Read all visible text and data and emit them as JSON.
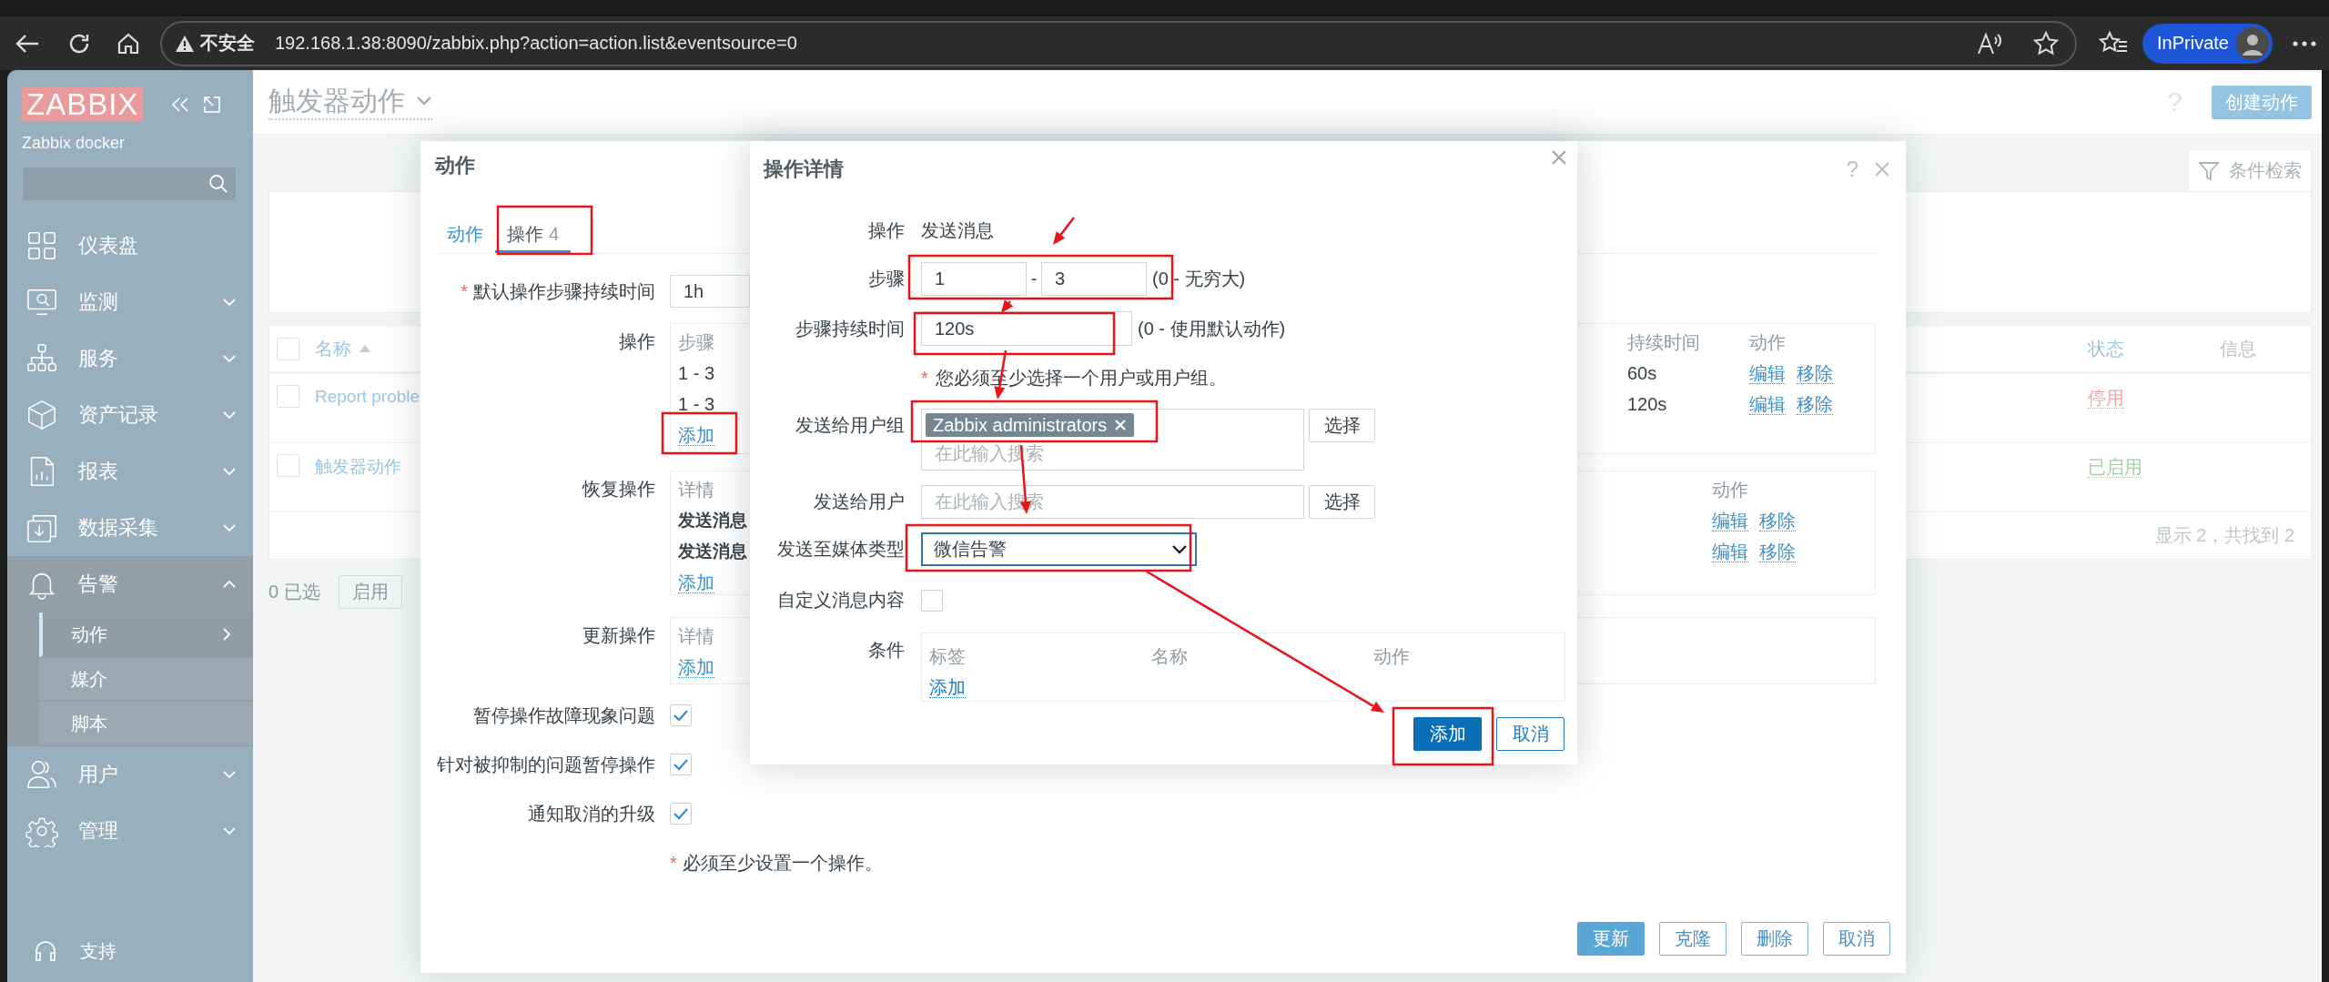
{
  "browser": {
    "security_label": "不安全",
    "url": "192.168.1.38:8090/zabbix.php?action=action.list&eventsource=0",
    "profile_label": "InPrivate"
  },
  "sidebar": {
    "logo": "ZABBIX",
    "server_name": "Zabbix docker",
    "menu": [
      {
        "label": "仪表盘",
        "kind": "link"
      },
      {
        "label": "监测",
        "kind": "group",
        "expanded": false
      },
      {
        "label": "服务",
        "kind": "group",
        "expanded": false
      },
      {
        "label": "资产记录",
        "kind": "group",
        "expanded": false
      },
      {
        "label": "报表",
        "kind": "group",
        "expanded": false
      },
      {
        "label": "数据采集",
        "kind": "group",
        "expanded": false
      },
      {
        "label": "告警",
        "kind": "group",
        "expanded": true,
        "children": [
          {
            "label": "动作",
            "selected": true
          },
          {
            "label": "媒介",
            "selected": false
          },
          {
            "label": "脚本",
            "selected": false
          }
        ]
      },
      {
        "label": "用户",
        "kind": "group",
        "expanded": false
      },
      {
        "label": "管理",
        "kind": "group",
        "expanded": false
      }
    ],
    "support": "支持"
  },
  "page": {
    "title": "触发器动作",
    "help": "?",
    "create_button": "创建动作",
    "filter_tab": "条件检索",
    "table": {
      "select_all_checked": false,
      "columns": [
        {
          "label": "名称",
          "link": true,
          "sorted": true
        },
        {
          "label": "状态",
          "link": true,
          "sorted": false
        },
        {
          "label": "信息",
          "link": false,
          "sorted": false
        }
      ],
      "rows": [
        {
          "name": "Report proble",
          "status": "停用",
          "enabled": false,
          "checked": false
        },
        {
          "name": "触发器动作",
          "status": "已启用",
          "enabled": true,
          "checked": false
        }
      ],
      "footer": "显示 2，共找到 2"
    },
    "selected_count": "0 已选",
    "mass_buttons": [
      "启用"
    ]
  },
  "action_dialog": {
    "title": "动作",
    "help": "?",
    "tabs": [
      {
        "label": "动作",
        "selected": false
      },
      {
        "label": "操作",
        "count": "4",
        "selected": true
      }
    ],
    "default_duration": {
      "mark": "*",
      "label": "默认操作步骤持续时间",
      "value": "1h"
    },
    "operations": {
      "label": "操作",
      "columns": [
        "步骤",
        "持续时间",
        "动作"
      ],
      "rows": [
        {
          "steps": "1 - 3",
          "duration": "60s",
          "actions": [
            "编辑",
            "移除"
          ]
        },
        {
          "steps": "1 - 3",
          "duration": "120s",
          "actions": [
            "编辑",
            "移除"
          ]
        }
      ],
      "add_link": "添加"
    },
    "recovery_operations": {
      "label": "恢复操作",
      "columns": [
        "详情",
        "动作"
      ],
      "rows": [
        {
          "details": "发送消息",
          "actions": [
            "编辑",
            "移除"
          ]
        },
        {
          "details": "发送消息",
          "actions": [
            "编辑",
            "移除"
          ]
        }
      ],
      "add_link": "添加"
    },
    "update_operations": {
      "label": "更新操作",
      "columns": [
        "详情"
      ],
      "add_link": "添加"
    },
    "options": [
      {
        "label": "暂停操作故障现象问题",
        "checked": true
      },
      {
        "label": "针对被抑制的问题暂停操作",
        "checked": true
      },
      {
        "label": "通知取消的升级",
        "checked": true
      }
    ],
    "note": {
      "mark": "*",
      "text": "必须至少设置一个操作。"
    },
    "buttons": [
      {
        "label": "更新",
        "primary": true
      },
      {
        "label": "克隆",
        "primary": false
      },
      {
        "label": "删除",
        "primary": false
      },
      {
        "label": "取消",
        "primary": false
      }
    ]
  },
  "operation_dialog": {
    "title": "操作详情",
    "operation": {
      "label": "操作",
      "value": "发送消息"
    },
    "steps": {
      "label": "步骤",
      "from": "1",
      "separator": "-",
      "to": "3",
      "hint": "(0 - 无穷大)"
    },
    "step_duration": {
      "label": "步骤持续时间",
      "value": "120s",
      "hint": "(0 - 使用默认动作)"
    },
    "warning": {
      "mark": "*",
      "text": "您必须至少选择一个用户或用户组。"
    },
    "user_groups": {
      "label": "发送给用户组",
      "tags": [
        "Zabbix administrators"
      ],
      "placeholder": "在此输入搜索",
      "button": "选择"
    },
    "users": {
      "label": "发送给用户",
      "placeholder": "在此输入搜索",
      "button": "选择"
    },
    "media_type": {
      "label": "发送至媒体类型",
      "value": "微信告警",
      "focused": true
    },
    "custom_message": {
      "label": "自定义消息内容",
      "checked": false
    },
    "conditions": {
      "label": "条件",
      "columns": [
        "标签",
        "名称",
        "动作"
      ],
      "add_link": "添加"
    },
    "buttons": [
      {
        "label": "添加",
        "primary": true
      },
      {
        "label": "取消",
        "primary": false
      }
    ]
  }
}
